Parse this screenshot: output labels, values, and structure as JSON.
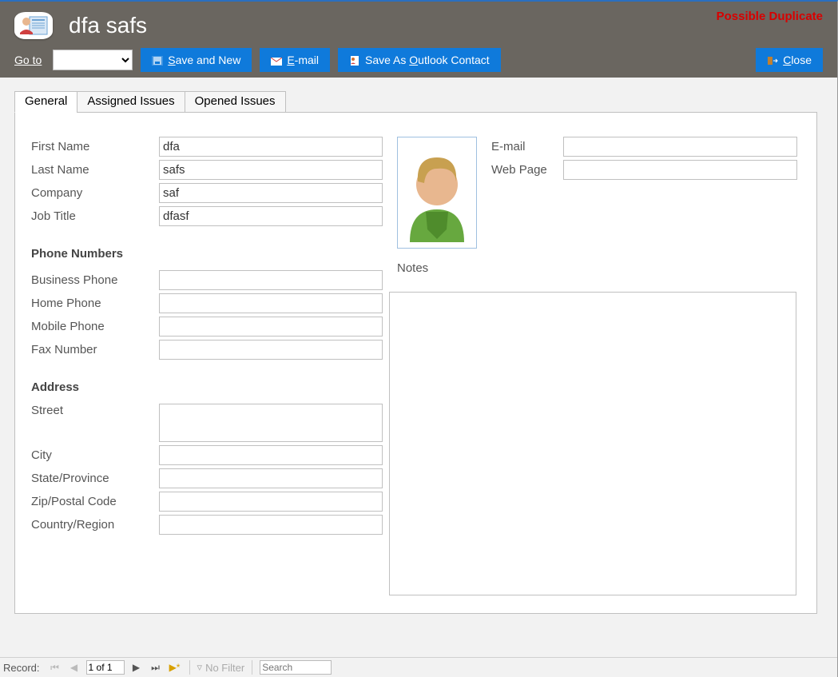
{
  "header": {
    "title": "dfa safs",
    "warning": "Possible Duplicate",
    "goto_label": "Go to"
  },
  "toolbar": {
    "save_new": "Save and New",
    "email": "E-mail",
    "save_outlook": "Save As Outlook Contact",
    "close": "Close"
  },
  "tabs": {
    "general": "General",
    "assigned": "Assigned Issues",
    "opened": "Opened Issues"
  },
  "labels": {
    "first_name": "First Name",
    "last_name": "Last Name",
    "company": "Company",
    "job_title": "Job Title",
    "phone_section": "Phone Numbers",
    "business_phone": "Business Phone",
    "home_phone": "Home Phone",
    "mobile_phone": "Mobile Phone",
    "fax": "Fax Number",
    "address_section": "Address",
    "street": "Street",
    "city": "City",
    "state": "State/Province",
    "zip": "Zip/Postal Code",
    "country": "Country/Region",
    "email": "E-mail",
    "webpage": "Web Page",
    "notes": "Notes"
  },
  "values": {
    "first_name": "dfa",
    "last_name": "safs",
    "company": "saf",
    "job_title": "dfasf",
    "business_phone": "",
    "home_phone": "",
    "mobile_phone": "",
    "fax": "",
    "street": "",
    "city": "",
    "state": "",
    "zip": "",
    "country": "",
    "email": "",
    "webpage": "",
    "notes": ""
  },
  "statusbar": {
    "record_label": "Record:",
    "record_pos": "1 of 1",
    "nofilter": "No Filter",
    "search_placeholder": "Search"
  }
}
